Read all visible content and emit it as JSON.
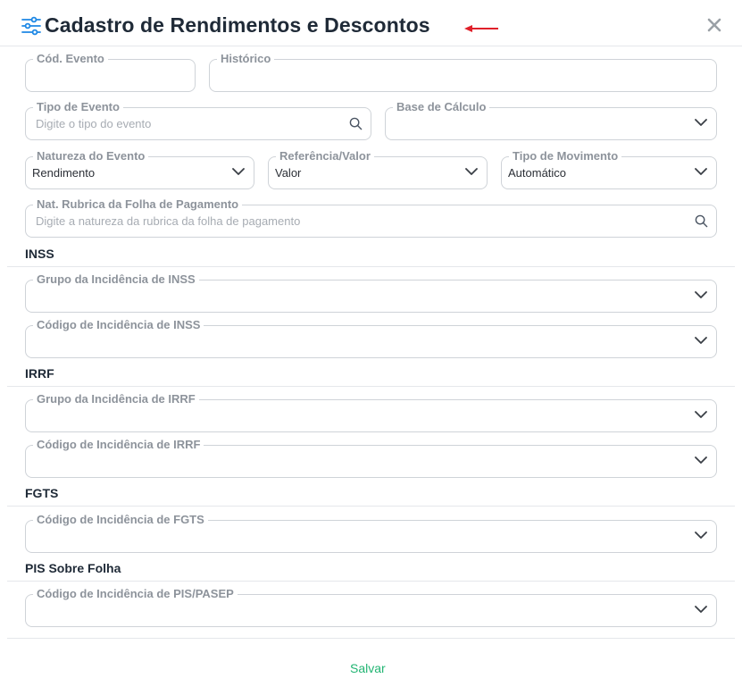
{
  "dialog": {
    "title": "Cadastro de Rendimentos e Descontos",
    "accent_color": "#1e88e5",
    "arrow_color": "#e0202a",
    "close_icon": "close-icon"
  },
  "fields": {
    "cod_evento": {
      "label": "Cód. Evento",
      "value": ""
    },
    "historico": {
      "label": "Histórico",
      "value": ""
    },
    "tipo_evento": {
      "label": "Tipo de Evento",
      "placeholder": "Digite o tipo do evento"
    },
    "base_calculo": {
      "label": "Base de Cálculo",
      "value": ""
    },
    "natureza_evento": {
      "label": "Natureza do Evento",
      "value": "Rendimento"
    },
    "referencia_valor": {
      "label": "Referência/Valor",
      "value": "Valor"
    },
    "tipo_movimento": {
      "label": "Tipo de Movimento",
      "value": "Automático"
    },
    "nat_rubrica": {
      "label": "Nat. Rubrica da Folha de Pagamento",
      "placeholder": "Digite a natureza da rubrica da folha de pagamento"
    }
  },
  "sections": {
    "inss": {
      "title": "INSS",
      "grupo": {
        "label": "Grupo da Incidência de INSS",
        "value": ""
      },
      "codigo": {
        "label": "Código de Incidência de INSS",
        "value": ""
      }
    },
    "irrf": {
      "title": "IRRF",
      "grupo": {
        "label": "Grupo da Incidência de IRRF",
        "value": ""
      },
      "codigo": {
        "label": "Código de Incidência de IRRF",
        "value": ""
      }
    },
    "fgts": {
      "title": "FGTS",
      "codigo": {
        "label": "Código de Incidência de FGTS",
        "value": ""
      }
    },
    "pis": {
      "title": "PIS Sobre Folha",
      "codigo": {
        "label": "Código de Incidência de PIS/PASEP",
        "value": ""
      }
    }
  },
  "footer": {
    "save_label": "Salvar",
    "save_color": "#22b573"
  }
}
